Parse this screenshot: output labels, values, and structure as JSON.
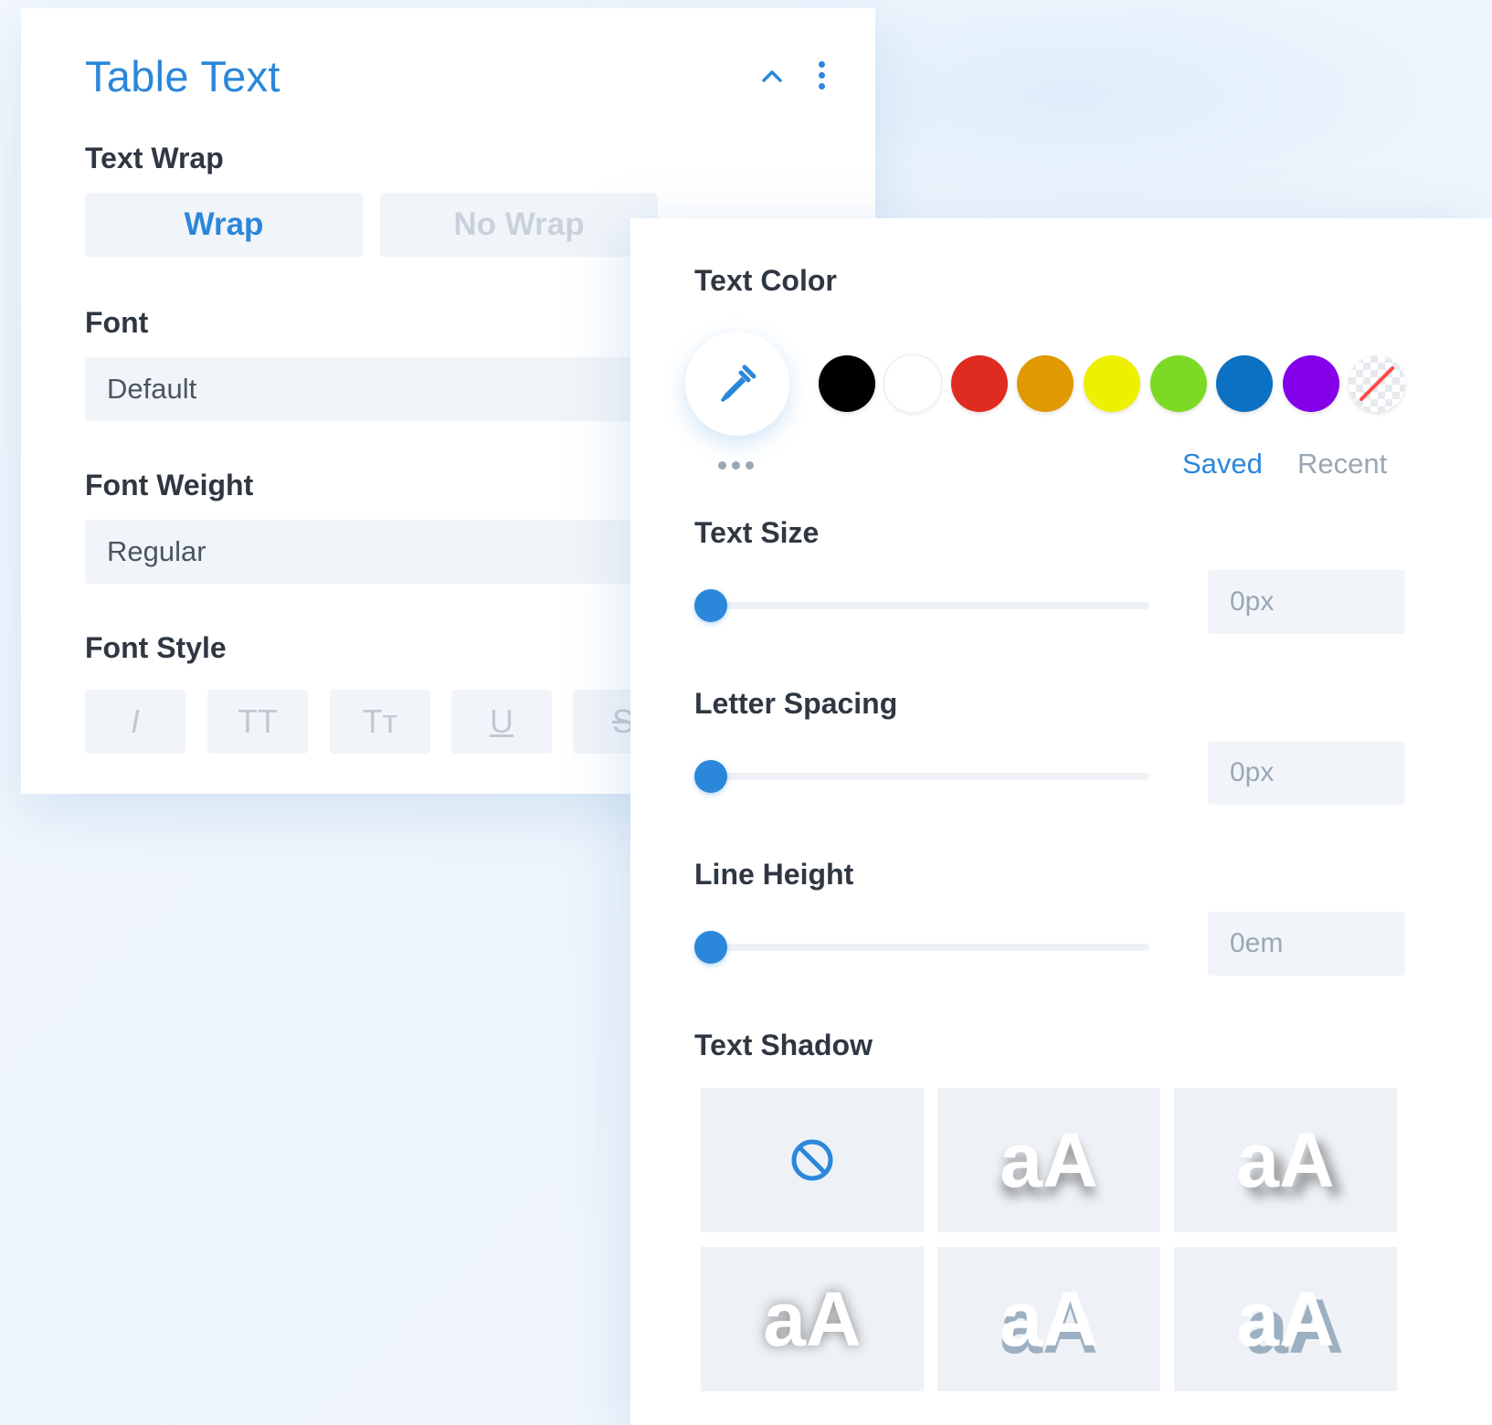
{
  "left_panel": {
    "title": "Table Text",
    "text_wrap": {
      "label": "Text Wrap",
      "options": [
        "Wrap",
        "No Wrap"
      ],
      "selected": "Wrap"
    },
    "font": {
      "label": "Font",
      "value": "Default"
    },
    "font_weight": {
      "label": "Font Weight",
      "value": "Regular"
    },
    "font_style": {
      "label": "Font Style",
      "buttons": [
        "I",
        "TT",
        "Tт",
        "U",
        "S"
      ]
    }
  },
  "right_panel": {
    "text_color": {
      "label": "Text Color",
      "swatches": [
        "#000000",
        "#ffffff",
        "#e02b20",
        "#e09900",
        "#edf000",
        "#7cda24",
        "#0c71c3",
        "#8300e9",
        "transparent"
      ],
      "tabs": [
        "Saved",
        "Recent"
      ],
      "active_tab": "Saved"
    },
    "text_size": {
      "label": "Text Size",
      "value": "0px",
      "slider": 0
    },
    "letter_spacing": {
      "label": "Letter Spacing",
      "value": "0px",
      "slider": 0
    },
    "line_height": {
      "label": "Line Height",
      "value": "0em",
      "slider": 0
    },
    "text_shadow": {
      "label": "Text Shadow",
      "presets": [
        "none",
        "aA",
        "aA",
        "aA",
        "aA",
        "aA"
      ]
    }
  },
  "colors": {
    "accent": "#2b87da",
    "label": "#2f3742",
    "muted": "#c0c9d3",
    "field_bg": "#f1f5f9"
  }
}
